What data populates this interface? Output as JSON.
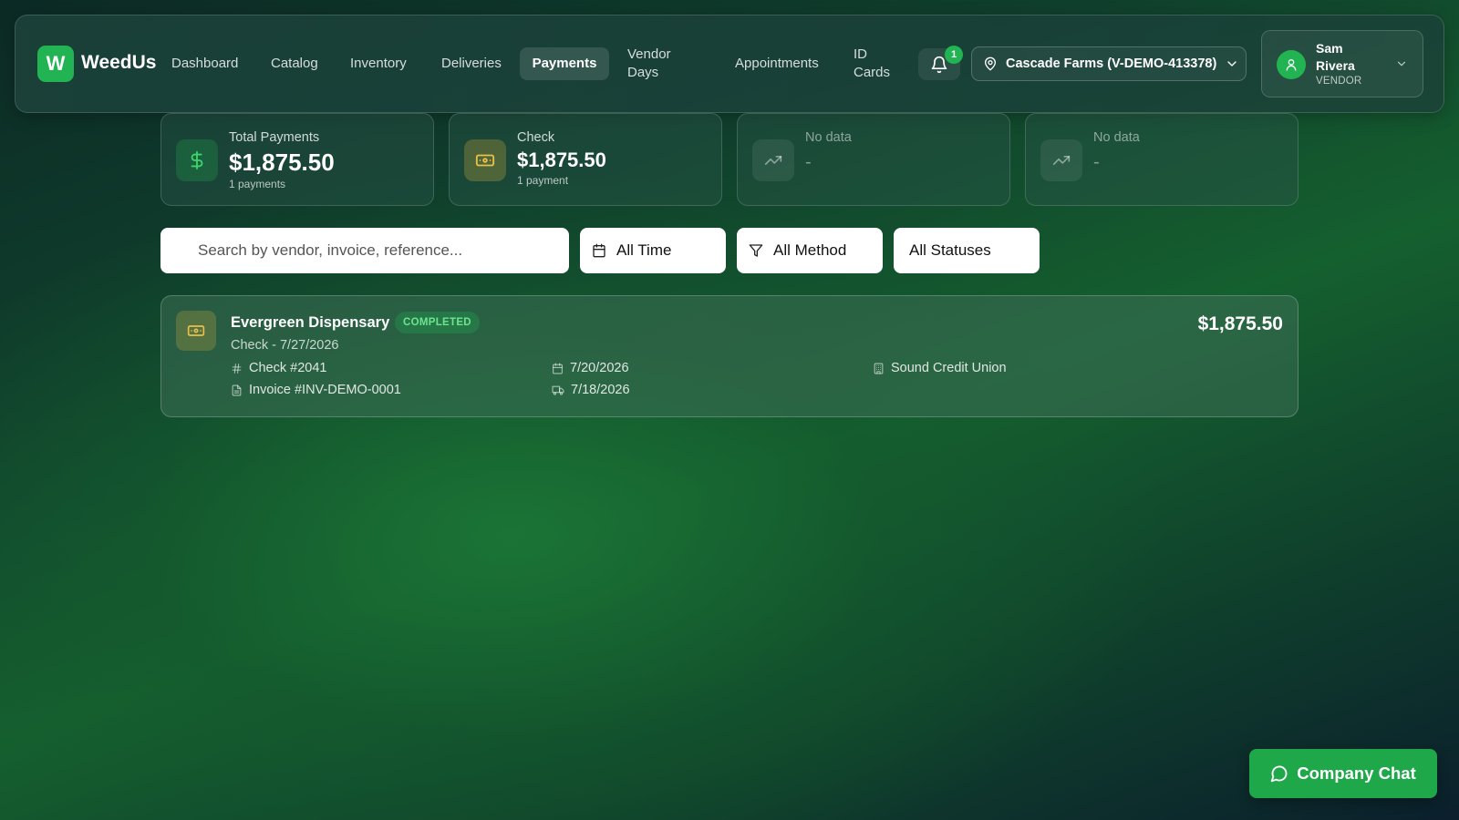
{
  "brand": {
    "logo_letter": "W",
    "name": "WeedUs",
    "accent": "#22b352"
  },
  "nav": {
    "items": [
      {
        "label": "Dashboard"
      },
      {
        "label": "Catalog"
      },
      {
        "label": "Inventory"
      },
      {
        "label": "Deliveries"
      },
      {
        "label": "Payments",
        "active": true
      },
      {
        "label": "Vendor Days"
      },
      {
        "label": "Appointments"
      },
      {
        "label": "ID Cards"
      }
    ]
  },
  "notifications": {
    "icon": "bell-icon",
    "count": "1"
  },
  "vendor_selector": {
    "icon": "map-pin-icon",
    "value": "Cascade Farms (V-DEMO-413378)"
  },
  "user": {
    "name": "Sam Rivera",
    "role": "VENDOR"
  },
  "stats": [
    {
      "icon": "dollar-icon",
      "label": "Total Payments",
      "value": "$1,875.50",
      "sub": "1 payments"
    },
    {
      "icon": "banknote-icon",
      "label": "Check",
      "value": "$1,875.50",
      "sub": "1 payment"
    },
    {
      "icon": "trending-up-icon",
      "label": "No data",
      "value": "-"
    },
    {
      "icon": "trending-up-icon",
      "label": "No data",
      "value": "-"
    }
  ],
  "filters": {
    "search_placeholder": "Search by vendor, invoice, reference...",
    "time": "All Time",
    "method": "All Methods",
    "status": "All Statuses"
  },
  "payments": [
    {
      "vendor": "Evergreen Dispensary",
      "status": "COMPLETED",
      "subtitle": "Check - 7/27/2026",
      "amount": "$1,875.50",
      "check_number": "Check #2041",
      "invoice": "Invoice #INV-DEMO-0001",
      "payment_date": "7/20/2026",
      "delivery_date": "7/18/2026",
      "bank": "Sound Credit Union"
    }
  ],
  "chat": {
    "label": "Company Chat"
  }
}
